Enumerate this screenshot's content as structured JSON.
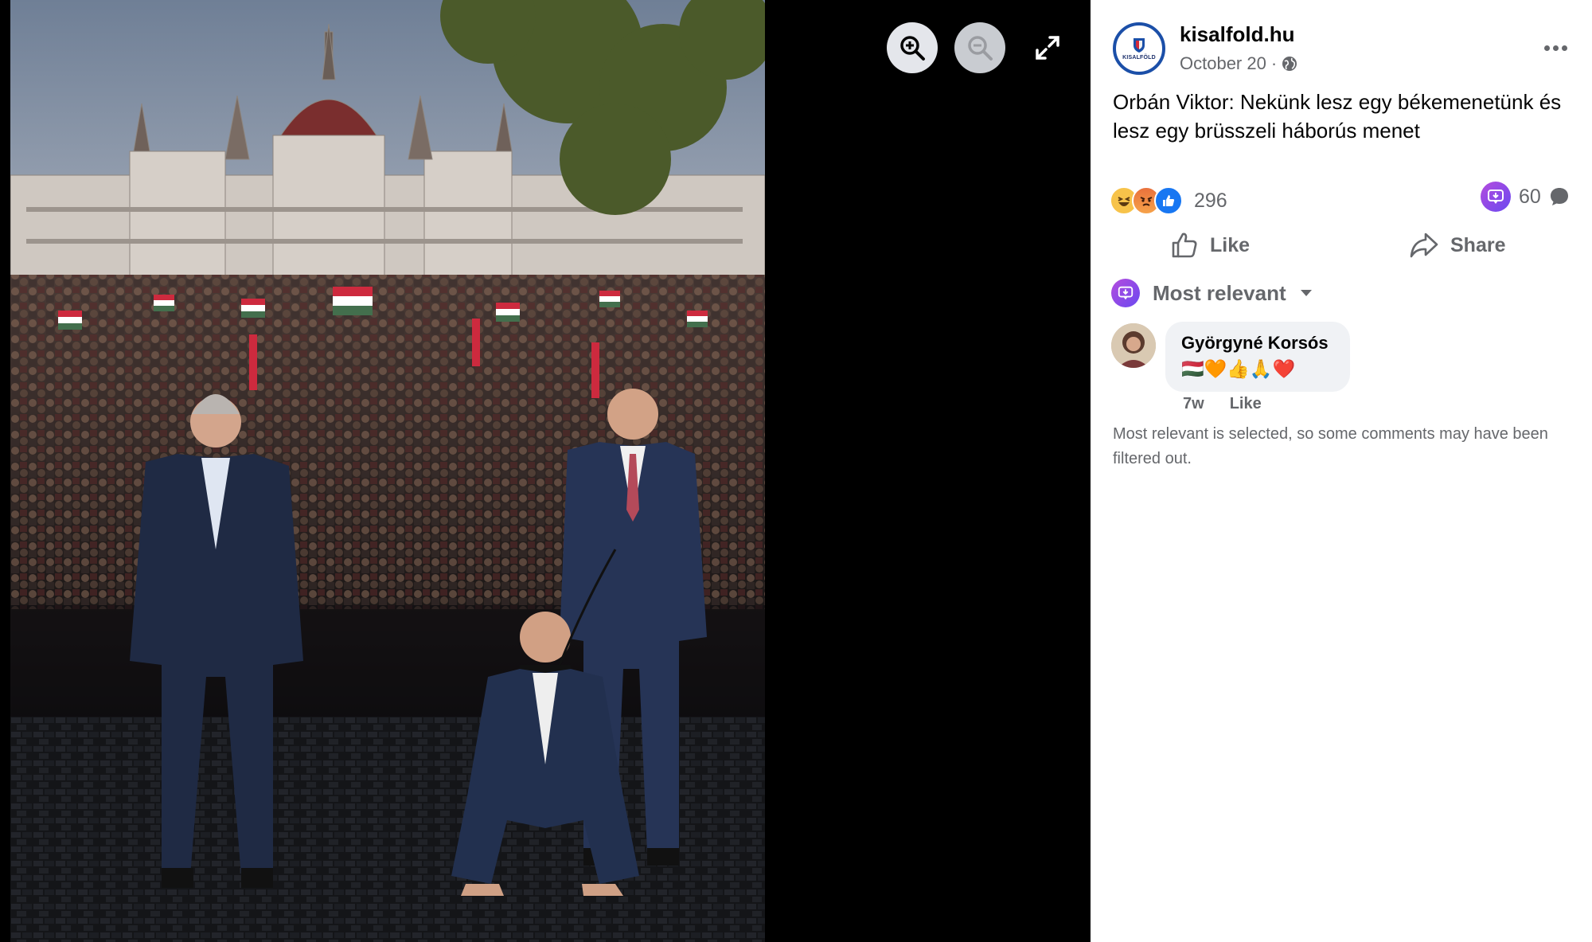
{
  "viewer": {
    "zoom_in_icon": "zoom-in-icon",
    "zoom_out_icon": "zoom-out-icon",
    "fullscreen_icon": "expand-icon"
  },
  "post": {
    "page_name": "kisalfold.hu",
    "avatar_label": "KISALFÖLD",
    "date": "October 20",
    "date_separator": "·",
    "audience_icon": "globe-icon",
    "text": "Orbán Viktor: Nekünk lesz egy békemenetünk és lesz egy brüsszeli háborús menet",
    "reaction_count": "296",
    "reaction_icons": [
      "haha-icon",
      "angry-icon",
      "like-icon"
    ],
    "comment_count": "60",
    "actions": {
      "like": "Like",
      "share": "Share"
    },
    "sort_label": "Most relevant"
  },
  "comments": [
    {
      "author": "Györgyné Korsós",
      "emojis": "🇭🇺🧡👍🙏❤️",
      "age": "7w",
      "like": "Like"
    }
  ],
  "filter_note": "Most relevant is selected, so some comments may have been filtered out.",
  "colors": {
    "brand_blue": "#1b4fa8",
    "secondary_text": "#65676b",
    "like_blue": "#1877f2",
    "ai_purple": "#8b4be8"
  }
}
